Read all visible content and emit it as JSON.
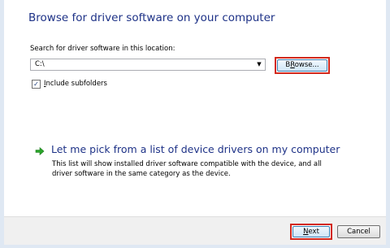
{
  "page": {
    "heading": "Browse for driver software on your computer",
    "search_label": "Search for driver software in this location:"
  },
  "location": {
    "value": "C:\\"
  },
  "browse_button": {
    "mnemonic": "R",
    "rest": "owse...",
    "prefix": "B"
  },
  "include_subfolders": {
    "checked": true,
    "mnemonic": "I",
    "rest": "nclude subfolders"
  },
  "pick_option": {
    "title": "Let me pick from a list of device drivers on my computer",
    "description": "This list will show installed driver software compatible with the device, and all driver software in the same category as the device."
  },
  "buttons": {
    "next_mnemonic": "N",
    "next_rest": "ext",
    "cancel": "Cancel"
  },
  "colors": {
    "highlight_border": "#d3291c",
    "link_blue": "#1e3287"
  }
}
